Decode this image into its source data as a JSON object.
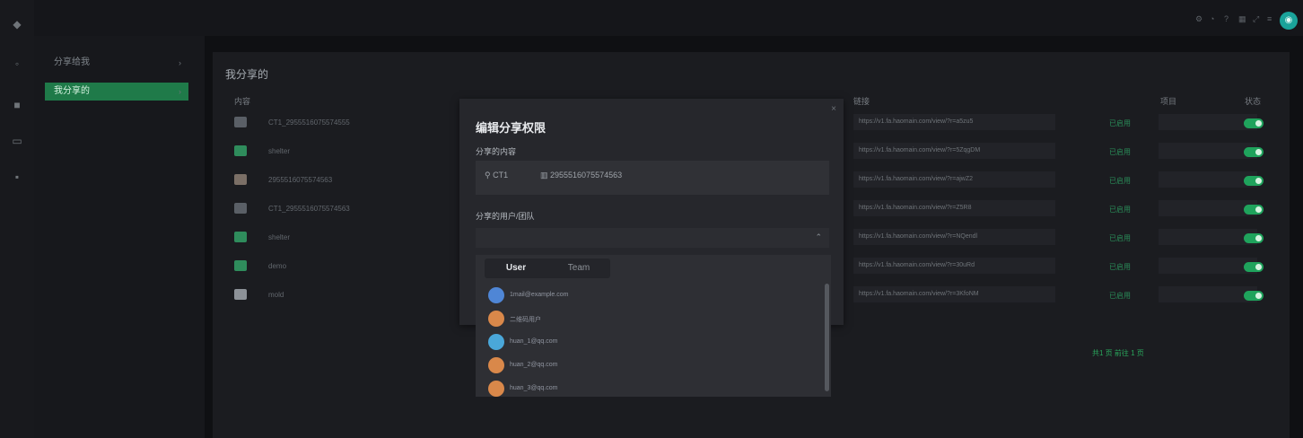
{
  "sidebar": {
    "items": [
      {
        "label": "分享给我",
        "active": false
      },
      {
        "label": "我分享的",
        "active": true
      }
    ]
  },
  "page": {
    "title": "我分享的"
  },
  "table": {
    "headers": [
      "内容",
      "链接",
      "项目",
      "状态"
    ],
    "rows": [
      {
        "name": "CT1_2955516075574555",
        "link": "https://v1.fa.haomain.com/view/?r=a5zu5",
        "status": "已启用"
      },
      {
        "name": "shelter",
        "link": "https://v1.fa.haomain.com/view/?r=5ZqgDM",
        "status": "已启用"
      },
      {
        "name": "2955516075574563",
        "link": "https://v1.fa.haomain.com/view/?r=ajwZ2",
        "status": "已启用"
      },
      {
        "name": "CT1_2955516075574563",
        "link": "https://v1.fa.haomain.com/view/?r=Z5R8",
        "status": "已启用"
      },
      {
        "name": "shelter",
        "link": "https://v1.fa.haomain.com/view/?r=NQendl",
        "status": "已启用"
      },
      {
        "name": "demo",
        "link": "https://v1.fa.haomain.com/view/?r=30uRd",
        "status": "已启用"
      },
      {
        "name": "mold",
        "link": "https://v1.fa.haomain.com/view/?r=3KfoNM",
        "status": "已启用"
      }
    ]
  },
  "pager": {
    "text": "共1 页  前往 1 页"
  },
  "modal": {
    "title": "编辑分享权限",
    "content_label": "分享的内容",
    "content_chip1": "CT1",
    "content_chip2": "2955516075574563",
    "users_label": "分享的用户/团队",
    "close": "×",
    "select_arrow": "⌃"
  },
  "dropdown": {
    "tabs": [
      "User",
      "Team"
    ],
    "users": [
      {
        "name": "1mail@example.com",
        "color": "#4f86d6"
      },
      {
        "name": "二维码用户",
        "color": "#d9884a"
      },
      {
        "name": "huan_1@qq.com",
        "color": "#4aa7d9"
      },
      {
        "name": "huan_2@qq.com",
        "color": "#d9884a"
      },
      {
        "name": "huan_3@qq.com",
        "color": "#d9884a"
      }
    ]
  },
  "colors": {
    "accent": "#1fa35c",
    "bg": "#0f1013"
  }
}
